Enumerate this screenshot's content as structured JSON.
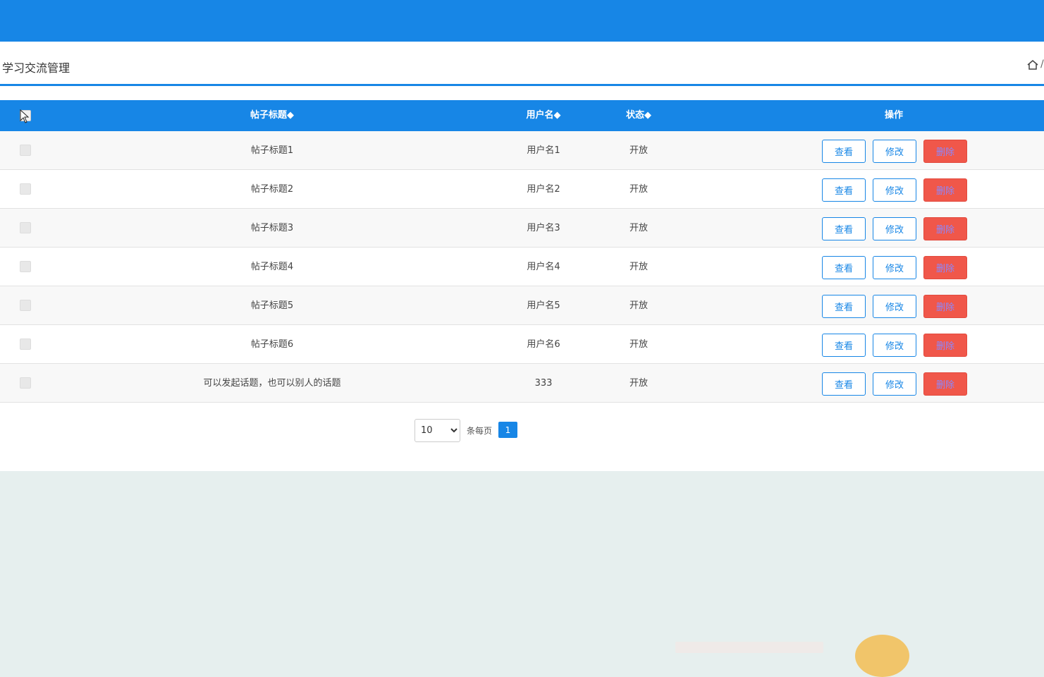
{
  "page": {
    "title": "学习交流管理",
    "breadcrumb_separator": "/",
    "icons": {
      "home": "home-icon",
      "sort": "sort-caret-icon"
    },
    "colors": {
      "accent": "#1786e6",
      "danger": "#f0574a",
      "background": "#e6efee"
    }
  },
  "table": {
    "headers": {
      "select": "",
      "title": "帖子标题◆",
      "username": "用户名◆",
      "status": "状态◆",
      "actions": "操作"
    },
    "rows": [
      {
        "title": "帖子标题1",
        "username": "用户名1",
        "status": "开放"
      },
      {
        "title": "帖子标题2",
        "username": "用户名2",
        "status": "开放"
      },
      {
        "title": "帖子标题3",
        "username": "用户名3",
        "status": "开放"
      },
      {
        "title": "帖子标题4",
        "username": "用户名4",
        "status": "开放"
      },
      {
        "title": "帖子标题5",
        "username": "用户名5",
        "status": "开放"
      },
      {
        "title": "帖子标题6",
        "username": "用户名6",
        "status": "开放"
      },
      {
        "title": "可以发起话题，也可以别人的话题",
        "username": "333",
        "status": "开放"
      }
    ],
    "actions": {
      "view": "查看",
      "edit": "修改",
      "delete": "删除"
    }
  },
  "pagination": {
    "page_size": "10",
    "page_size_options": [
      "10"
    ],
    "per_page_label": "条每页",
    "current_page": "1"
  }
}
